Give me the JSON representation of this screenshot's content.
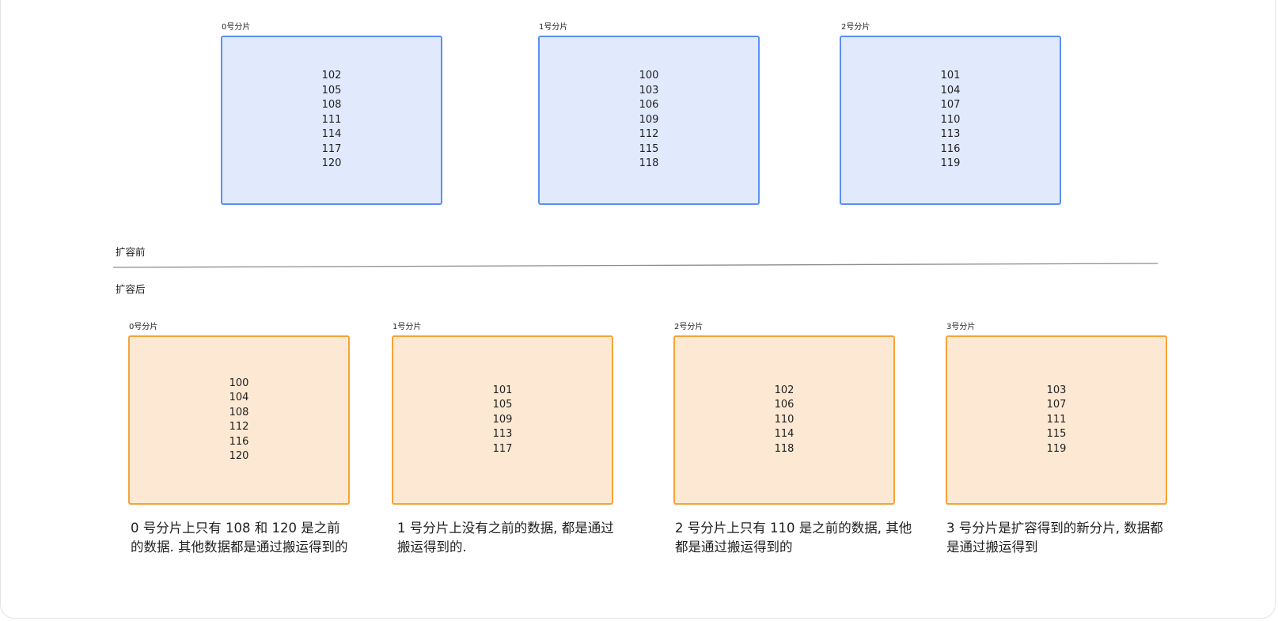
{
  "before": {
    "label": "扩容前",
    "shards": [
      {
        "title": "0号分片",
        "values": [
          "102",
          "105",
          "108",
          "111",
          "114",
          "117",
          "120"
        ]
      },
      {
        "title": "1号分片",
        "values": [
          "100",
          "103",
          "106",
          "109",
          "112",
          "115",
          "118"
        ]
      },
      {
        "title": "2号分片",
        "values": [
          "101",
          "104",
          "107",
          "110",
          "113",
          "116",
          "119"
        ]
      }
    ]
  },
  "after": {
    "label": "扩容后",
    "shards": [
      {
        "title": "0号分片",
        "values": [
          "100",
          "104",
          "108",
          "112",
          "116",
          "120"
        ],
        "note": "0 号分片上只有 108 和 120 是之前的数据. 其他数据都是通过搬运得到的"
      },
      {
        "title": "1号分片",
        "values": [
          "101",
          "105",
          "109",
          "113",
          "117"
        ],
        "note": "1 号分片上没有之前的数据, 都是通过搬运得到的."
      },
      {
        "title": "2号分片",
        "values": [
          "102",
          "106",
          "110",
          "114",
          "118"
        ],
        "note": "2 号分片上只有 110 是之前的数据, 其他都是通过搬运得到的"
      },
      {
        "title": "3号分片",
        "values": [
          "103",
          "107",
          "111",
          "115",
          "119"
        ],
        "note": "3 号分片是扩容得到的新分片, 数据都是通过搬运得到"
      }
    ]
  },
  "colors": {
    "before_fill": "#e1eafd",
    "before_border": "#5b8ff2",
    "after_fill": "#fde9d3",
    "after_border": "#f5a338"
  }
}
